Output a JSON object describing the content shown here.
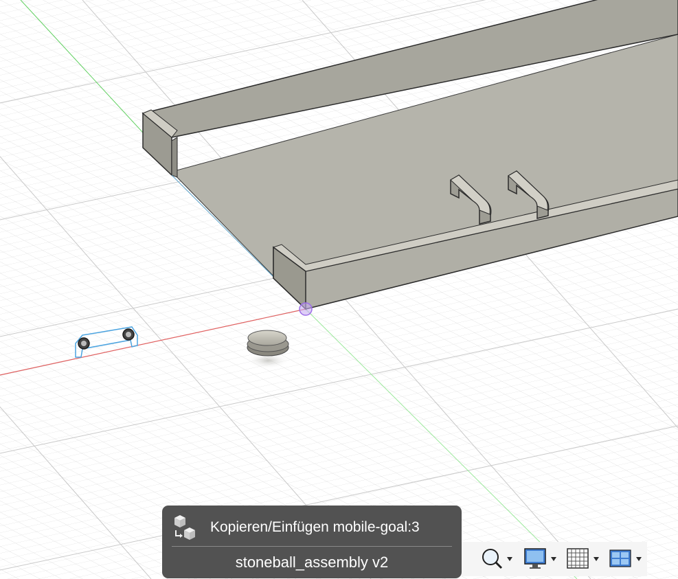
{
  "notification": {
    "command_label": "Kopieren/Einfügen mobile-goal:3",
    "document_name": "stoneball_assembly v2",
    "icon": "copy-paste-icon"
  },
  "navigation_toolbar": {
    "buttons": [
      {
        "name": "zoom-button",
        "icon": "zoom-magnifier-icon",
        "has_dropdown": true
      },
      {
        "name": "display-settings-button",
        "icon": "monitor-icon",
        "has_dropdown": true
      },
      {
        "name": "grid-settings-button",
        "icon": "grid-icon",
        "has_dropdown": true
      },
      {
        "name": "viewports-button",
        "icon": "viewports-icon",
        "has_dropdown": true
      }
    ]
  },
  "colors": {
    "toast_bg": "#525252",
    "x_axis": "#e06060",
    "y_axis": "#60d060",
    "origin_marker": "#9d6ee8",
    "tray_body": "#a9a89f",
    "selection_outline": "#4aa3e0"
  }
}
